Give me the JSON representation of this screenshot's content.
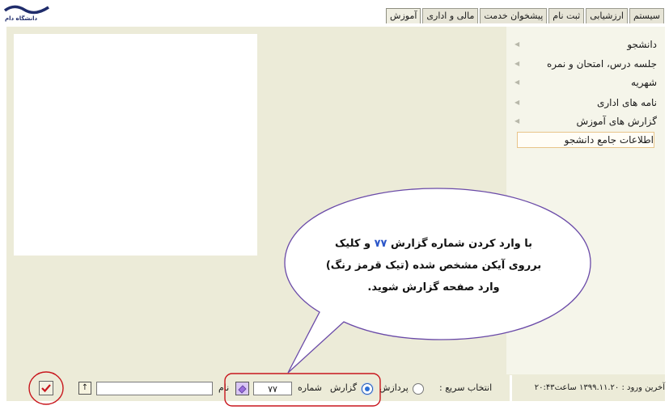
{
  "logo": {
    "text": "دانشگاه دام"
  },
  "tabs": [
    "آموزش",
    "مالی و اداری",
    "پیشخوان خدمت",
    "ثبت نام",
    "ارزشیابی",
    "سیستم"
  ],
  "menu": [
    {
      "label": "دانشجو"
    },
    {
      "label": "جلسه درس، امتحان و نمره"
    },
    {
      "label": "شهریه"
    },
    {
      "label": "نامه های اداری"
    },
    {
      "label": "گزارش های آموزش"
    },
    {
      "label": "اطلاعات جامع دانشجو"
    }
  ],
  "bottom": {
    "last_login": "آخرین ورود : ۱۳۹۹.۱۱.۲۰ ساعت۲۰:۴۳",
    "quick_select_label": "انتخاب سریع :",
    "process_label": "پردازش",
    "report_label": "گزارش",
    "number_label": "شماره",
    "number_value": "۷۷",
    "name_label": "نام",
    "up_button": "↑",
    "selected_mode": "report"
  },
  "callout": {
    "line1_prefix": "با وارد کردن شماره گزارش",
    "line1_number": "۷۷",
    "line1_suffix": "و کلیک",
    "line2": "برروی آیکن مشخص شده (تیک قرمز رنگ)",
    "line3": "وارد صفحه گزارش شوید."
  },
  "colors": {
    "panel": "#ecebd8",
    "annotation_red": "#c8161d",
    "callout_border": "#6a4aa8",
    "highlight_number": "#2d57c9"
  },
  "icons": [
    "eraser-icon",
    "arrow-up-icon",
    "checkmark-icon",
    "menu-arrow-icon"
  ]
}
